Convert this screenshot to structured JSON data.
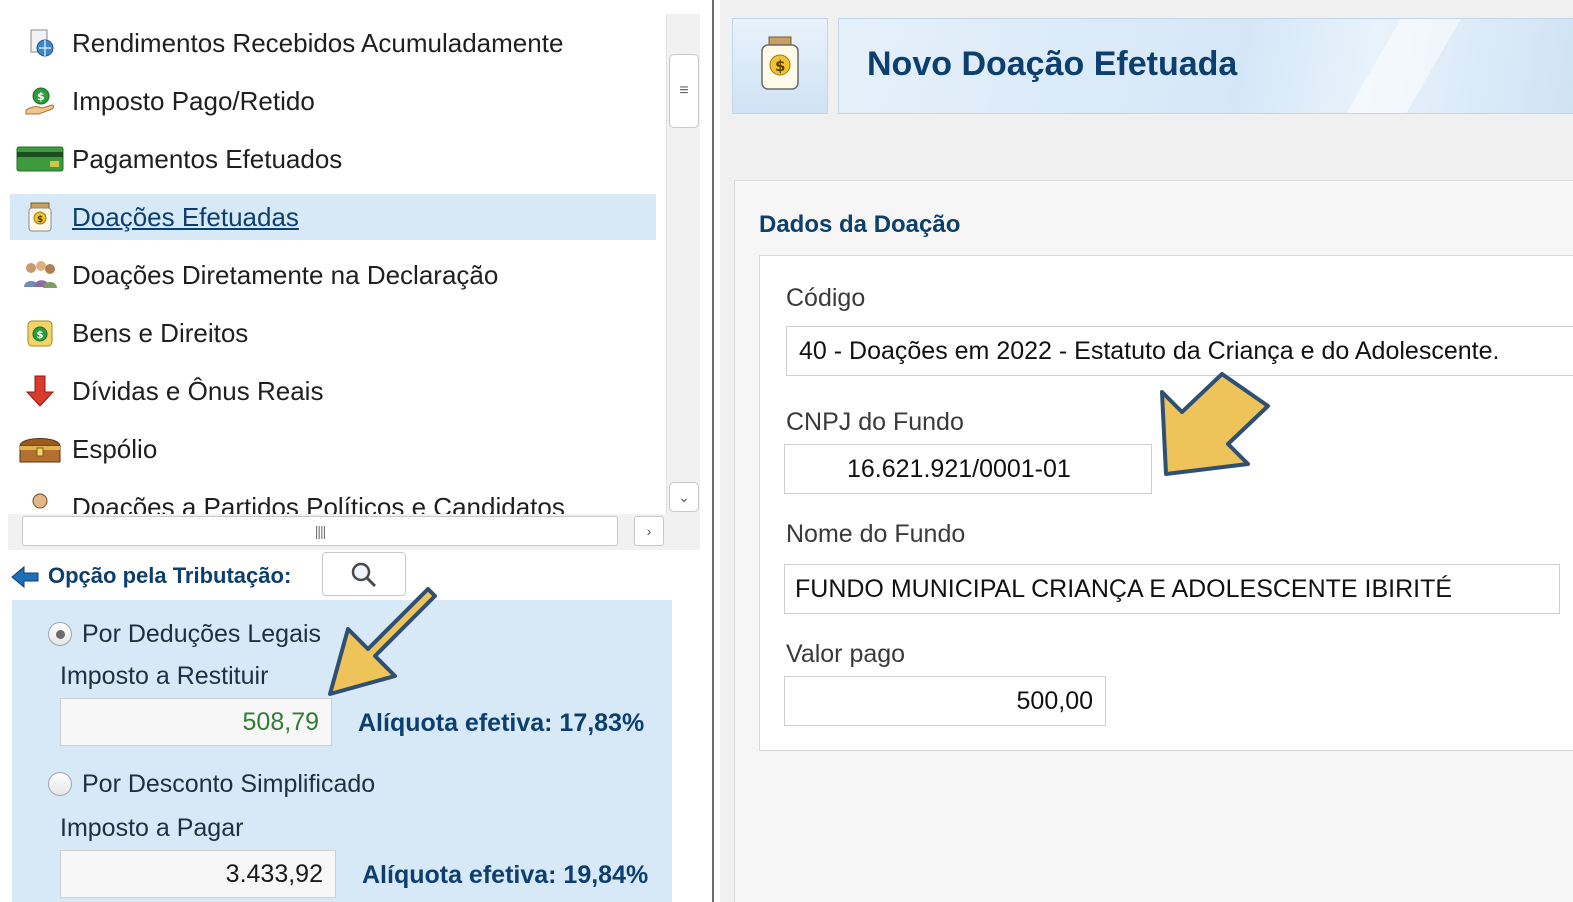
{
  "sidebar": {
    "items": [
      {
        "label": "Rendimentos Recebidos Acumuladamente",
        "icon": "globe-document-icon"
      },
      {
        "label": "Imposto Pago/Retido",
        "icon": "money-hand-icon"
      },
      {
        "label": "Pagamentos Efetuados",
        "icon": "credit-card-icon"
      },
      {
        "label": "Doações Efetuadas",
        "icon": "donation-jar-icon",
        "selected": true
      },
      {
        "label": "Doações Diretamente na Declaração",
        "icon": "people-group-icon"
      },
      {
        "label": "Bens e Direitos",
        "icon": "money-bag-icon"
      },
      {
        "label": "Dívidas e Ônus Reais",
        "icon": "red-down-arrow-icon"
      },
      {
        "label": "Espólio",
        "icon": "treasure-chest-icon"
      },
      {
        "label": "Doações a Partidos Políticos e Candidatos",
        "icon": "person-icon"
      }
    ]
  },
  "tax_option": {
    "title": "Opção pela Tributação:",
    "legal": {
      "label": "Por Deduções Legais",
      "selected": true,
      "result_label": "Imposto a Restituir",
      "value": "508,79",
      "rate": "Alíquota efetiva: 17,83%"
    },
    "simplified": {
      "label": "Por Desconto Simplificado",
      "selected": false,
      "result_label": "Imposto a Pagar",
      "value": "3.433,92",
      "rate": "Alíquota efetiva: 19,84%"
    }
  },
  "header": {
    "title": "Novo Doação Efetuada"
  },
  "form": {
    "section_title": "Dados da Doação",
    "codigo": {
      "label": "Código",
      "value": "40 - Doações em 2022 - Estatuto da Criança e do Adolescente."
    },
    "cnpj": {
      "label": "CNPJ do Fundo",
      "value": "16.621.921/0001-01"
    },
    "nome": {
      "label": "Nome do Fundo",
      "value": "FUNDO MUNICIPAL CRIANÇA E ADOLESCENTE IBIRITÉ"
    },
    "valor": {
      "label": "Valor pago",
      "value": "500,00"
    }
  },
  "colors": {
    "accent": "#0c3f6e",
    "selection": "#d7e8f7",
    "positive_value": "#2e7d32",
    "callout_fill": "#eec35a",
    "callout_stroke": "#2f4f73"
  }
}
